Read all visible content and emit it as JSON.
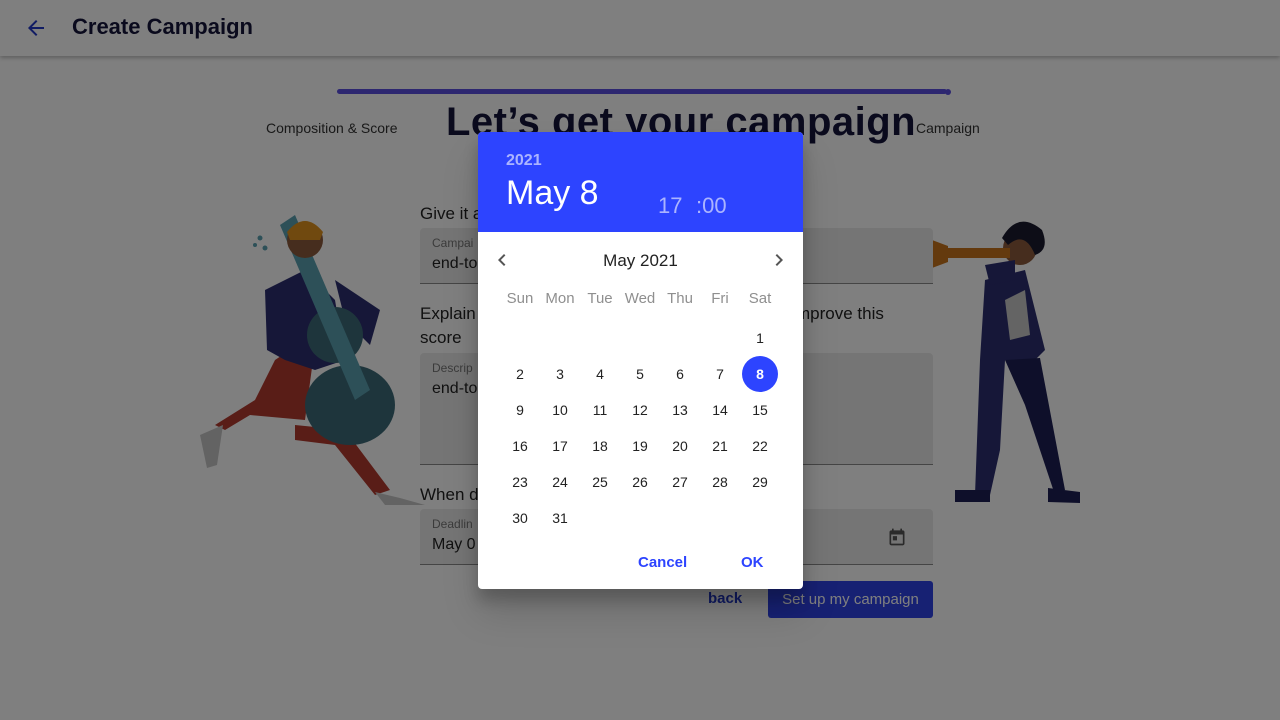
{
  "appbar": {
    "title": "Create Campaign"
  },
  "stepper": {
    "left_label": "Composition & Score",
    "right_label": "Campaign",
    "progress": 1.0
  },
  "headline": "Let’s get your campaign",
  "form": {
    "name_question": "Give it a",
    "name_field": {
      "label": "Campai",
      "value": "end-to"
    },
    "explain_question_start": "Explain",
    "explain_question_end": "mprove this",
    "explain_question_line2": "score",
    "description_field": {
      "label": "Descrip",
      "value": "end-to"
    },
    "when_question": "When d",
    "deadline_field": {
      "label": "Deadlin",
      "value": "May 0"
    }
  },
  "buttons": {
    "back": "back",
    "setup": "Set up my campaign"
  },
  "datepicker": {
    "year": "2021",
    "date": "May 8",
    "hour": "17",
    "minute": ":00",
    "month_title": "May 2021",
    "weekdays": [
      "Sun",
      "Mon",
      "Tue",
      "Wed",
      "Thu",
      "Fri",
      "Sat"
    ],
    "first_weekday_index": 6,
    "days_in_month": 31,
    "selected_day": 8,
    "cancel_label": "Cancel",
    "ok_label": "OK"
  },
  "colors": {
    "primary": "#2d44ff",
    "progress": "#5b4ee0",
    "button": "#2f43e6",
    "headline": "#14143a"
  },
  "icons": {
    "appbar_back": "arrow-left-icon",
    "prev_month": "chevron-left-icon",
    "next_month": "chevron-right-icon",
    "deadline": "calendar-icon"
  }
}
